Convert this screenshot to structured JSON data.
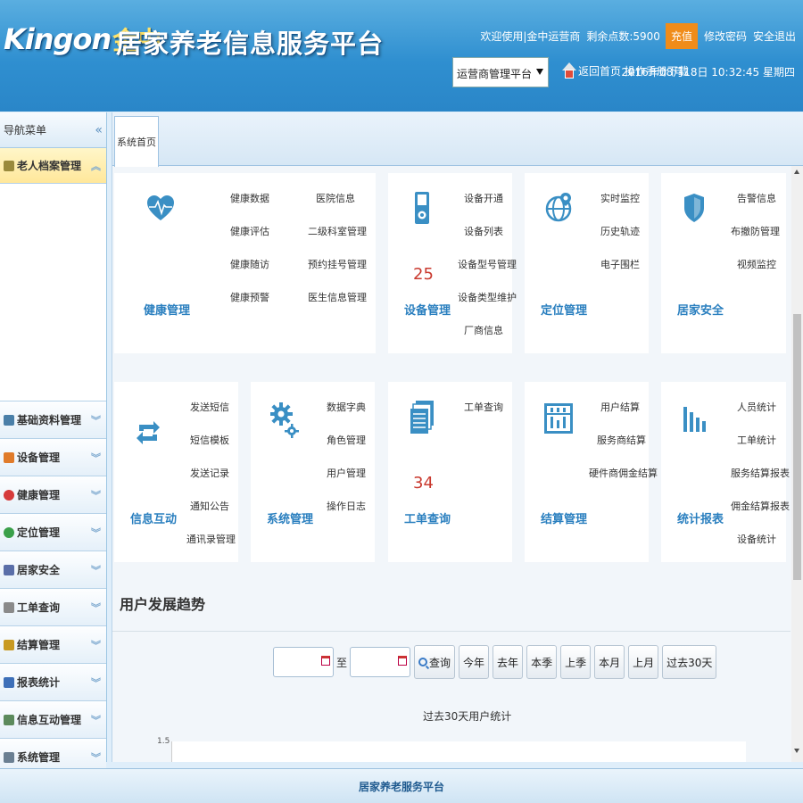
{
  "header": {
    "logo_en": "Kingon",
    "logo_cn": "金中",
    "app_title": "居家养老信息服务平台",
    "welcome": "欢迎使用|金中运营商",
    "balance": "剩余点数:5900",
    "recharge": "充值",
    "change_password": "修改密码",
    "logout": "安全退出",
    "platform_selected": "运营商管理平台",
    "home": "返回首页",
    "manual_download": "操作手册下载",
    "datetime": "2016年08月18日 10:32:45 星期四"
  },
  "sidebar": {
    "title": "导航菜单",
    "items": [
      {
        "label": "老人档案管理",
        "icon_color": "#9a8a3c"
      },
      {
        "label": "基础资料管理",
        "icon_color": "#4a7fa8"
      },
      {
        "label": "设备管理",
        "icon_color": "#e07b2a"
      },
      {
        "label": "健康管理",
        "icon_color": "#d63b3b"
      },
      {
        "label": "定位管理",
        "icon_color": "#3aa04a"
      },
      {
        "label": "居家安全",
        "icon_color": "#5a6ea8"
      },
      {
        "label": "工单查询",
        "icon_color": "#8a8a8a"
      },
      {
        "label": "结算管理",
        "icon_color": "#c89a22"
      },
      {
        "label": "报表统计",
        "icon_color": "#3d6fb8"
      },
      {
        "label": "信息互动管理",
        "icon_color": "#5c8a5c"
      },
      {
        "label": "系统管理",
        "icon_color": "#6a7f92"
      }
    ]
  },
  "tab": {
    "label": "系统首页"
  },
  "cards": {
    "health": {
      "title": "健康管理",
      "links": [
        "健康数据",
        "健康评估",
        "健康随访",
        "健康预警",
        "医院信息",
        "二级科室管理",
        "预约挂号管理",
        "医生信息管理"
      ]
    },
    "device": {
      "title": "设备管理",
      "count": "25",
      "links": [
        "设备开通",
        "设备列表",
        "设备型号管理",
        "设备类型维护",
        "厂商信息"
      ]
    },
    "location": {
      "title": "定位管理",
      "links": [
        "实时监控",
        "历史轨迹",
        "电子围栏"
      ]
    },
    "security": {
      "title": "居家安全",
      "links": [
        "告警信息",
        "布撤防管理",
        "视频监控"
      ]
    },
    "message": {
      "title": "信息互动",
      "links": [
        "发送短信",
        "短信模板",
        "发送记录",
        "通知公告",
        "通讯录管理"
      ]
    },
    "system": {
      "title": "系统管理",
      "links": [
        "数据字典",
        "角色管理",
        "用户管理",
        "操作日志"
      ]
    },
    "workorder": {
      "title": "工单查询",
      "count": "34",
      "links": [
        "工单查询"
      ]
    },
    "settlement": {
      "title": "结算管理",
      "links": [
        "用户结算",
        "服务商结算",
        "硬件商佣金结算"
      ]
    },
    "report": {
      "title": "统计报表",
      "links": [
        "人员统计",
        "工单统计",
        "服务结算报表",
        "佣金结算报表",
        "设备统计"
      ]
    }
  },
  "trend": {
    "title": "用户发展趋势",
    "to_label": "至",
    "buttons": [
      "查询",
      "今年",
      "去年",
      "本季",
      "上季",
      "本月",
      "上月",
      "过去30天"
    ]
  },
  "chart_data": {
    "type": "line",
    "title": "过去30天用户统计",
    "y_ticks": [
      "1.5"
    ]
  },
  "footer": {
    "text": "居家养老服务平台"
  }
}
